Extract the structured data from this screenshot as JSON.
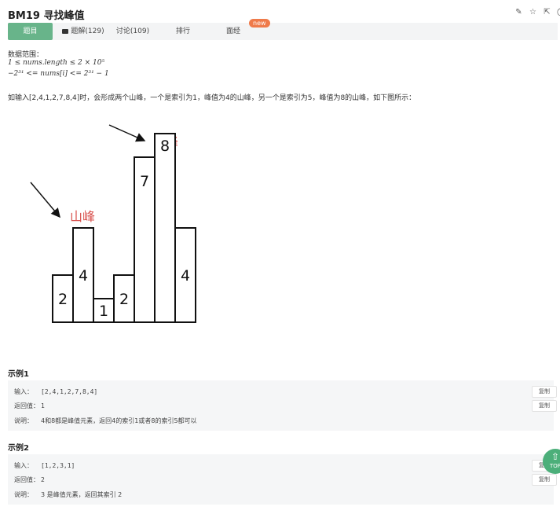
{
  "problem": {
    "title": "BM19  寻找峰值"
  },
  "toolbar": {
    "icons": [
      "edit-icon",
      "star-icon",
      "external-link-icon",
      "circle-icon"
    ]
  },
  "tabs": [
    {
      "label": "题目"
    },
    {
      "label": "题解(129)"
    },
    {
      "label": "讨论(109)"
    },
    {
      "label": "排行"
    },
    {
      "label": "面经"
    }
  ],
  "new_badge": "new",
  "range": {
    "heading": "数据范围：",
    "line1": "1 ≤ nums.length ≤ 2 × 10⁵",
    "line2": "−2³¹ <= nums[i] <= 2³¹ − 1"
  },
  "description": "如输入[2,4,1,2,7,8,4]时，会形成两个山峰，一个是索引为1，峰值为4的山峰，另一个是索引为5，峰值为8的山峰，如下图所示：",
  "figure": {
    "bar_values": [
      2,
      4,
      1,
      2,
      7,
      8,
      4
    ],
    "peak_label_left": "山峰",
    "peak_label_right": "山峰"
  },
  "examples": [
    {
      "title": "示例1",
      "input_label": "输入：",
      "input": "[2,4,1,2,7,8,4]",
      "return_label": "返回值：",
      "return_value": "1",
      "explain_label": "说明：",
      "explanation": "4和8都是峰值元素，返回4的索引1或者8的索引5都可以"
    },
    {
      "title": "示例2",
      "input_label": "输入：",
      "input": "[1,2,3,1]",
      "return_label": "返回值：",
      "return_value": "2",
      "explain_label": "说明：",
      "explanation": "3 是峰值元素，返回其索引 2"
    }
  ],
  "copy_label": "复制",
  "back_to_top": "TOP"
}
